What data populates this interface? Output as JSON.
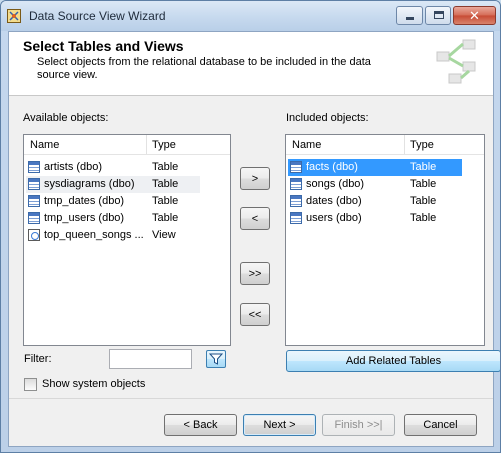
{
  "window": {
    "title": "Data Source View Wizard"
  },
  "header": {
    "title": "Select Tables and Views",
    "subtitle": "Select objects from the relational database to be included in the data source view."
  },
  "available": {
    "label": "Available objects:",
    "col_name": "Name",
    "col_type": "Type",
    "rows": [
      {
        "name": "artists (dbo)",
        "type": "Table",
        "icon": "table-icon"
      },
      {
        "name": "sysdiagrams (dbo)",
        "type": "Table",
        "icon": "table-icon"
      },
      {
        "name": "tmp_dates (dbo)",
        "type": "Table",
        "icon": "table-icon"
      },
      {
        "name": "tmp_users (dbo)",
        "type": "Table",
        "icon": "table-icon"
      },
      {
        "name": "top_queen_songs ...",
        "type": "View",
        "icon": "view-icon"
      }
    ]
  },
  "included": {
    "label": "Included objects:",
    "col_name": "Name",
    "col_type": "Type",
    "rows": [
      {
        "name": "facts (dbo)",
        "type": "Table",
        "icon": "table-icon"
      },
      {
        "name": "songs (dbo)",
        "type": "Table",
        "icon": "table-icon"
      },
      {
        "name": "dates (dbo)",
        "type": "Table",
        "icon": "table-icon"
      },
      {
        "name": "users (dbo)",
        "type": "Table",
        "icon": "table-icon"
      }
    ]
  },
  "transfer": {
    "add": ">",
    "remove": "<",
    "add_all": ">>",
    "remove_all": "<<"
  },
  "filter": {
    "label": "Filter:",
    "value": ""
  },
  "add_related_label": "Add Related Tables",
  "show_system_label": "Show system objects",
  "show_system_checked": false,
  "footer": {
    "back": "< Back",
    "next": "Next >",
    "finish": "Finish >>|",
    "cancel": "Cancel"
  },
  "colors": {
    "selection": "#3399ff",
    "title_bar": "#c6d9ee",
    "close_button": "#c74a34"
  }
}
